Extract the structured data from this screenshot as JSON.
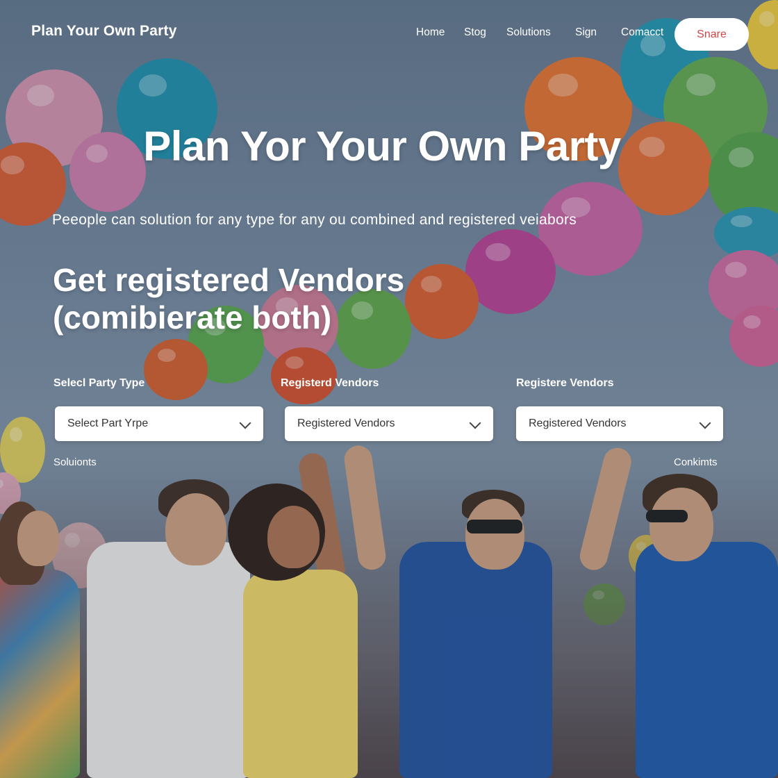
{
  "header": {
    "site_title": "Plan Your Own Party",
    "nav": [
      "Home",
      "Stog",
      "Solutions",
      "Sign",
      "Comacct"
    ],
    "cta_label": "Snare"
  },
  "hero": {
    "title": "Plan Yor Your Own Party",
    "subtitle": "Peeople can solution for any  type for any ou combined and registered veiabors"
  },
  "vendors": {
    "title_line1": "Get registered Vendors",
    "title_line2": "(comibierate both)",
    "fields": [
      {
        "label": "Selecl Party Type",
        "value": "Select Part Yrpe"
      },
      {
        "label": "Registerd Vendors",
        "value": "Registered Vendors"
      },
      {
        "label": "Registere Vendors",
        "value": "Registered Vendors"
      }
    ],
    "left_link": "Soluionts",
    "right_link": "Conkimts"
  },
  "colors": {
    "accent": "#d64545",
    "background": "#6d7f94"
  }
}
